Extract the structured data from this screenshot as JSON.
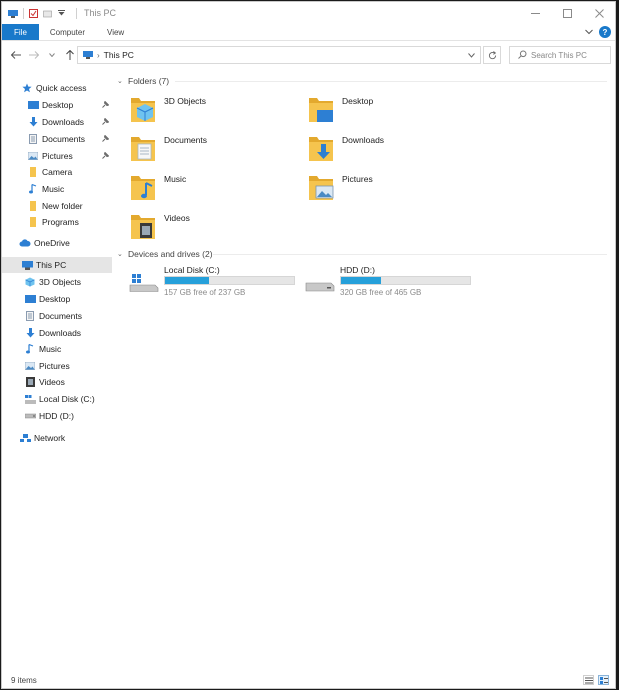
{
  "window": {
    "title": "This PC",
    "qat_dropdown_icon": "chevron-down-icon",
    "colors": {
      "accent": "#1979ca",
      "drive_fill": "#26a0da",
      "folder": "#f5c44e"
    }
  },
  "ribbon": {
    "tabs": [
      {
        "label": "File"
      },
      {
        "label": "Computer"
      },
      {
        "label": "View"
      }
    ],
    "help_label": "?"
  },
  "address": {
    "location": "This PC",
    "search_placeholder": "Search This PC"
  },
  "nav_pane": {
    "quick_access": {
      "label": "Quick access",
      "items": [
        {
          "label": "Desktop",
          "icon": "desktop-icon",
          "pinned": true
        },
        {
          "label": "Downloads",
          "icon": "download-icon",
          "pinned": true
        },
        {
          "label": "Documents",
          "icon": "document-icon",
          "pinned": true
        },
        {
          "label": "Pictures",
          "icon": "picture-icon",
          "pinned": true
        },
        {
          "label": "Camera",
          "icon": "folder-icon",
          "pinned": false
        },
        {
          "label": "Music",
          "icon": "music-icon",
          "pinned": false
        },
        {
          "label": "New folder",
          "icon": "folder-icon",
          "pinned": false
        },
        {
          "label": "Programs",
          "icon": "folder-icon",
          "pinned": false
        }
      ]
    },
    "onedrive": {
      "label": "OneDrive"
    },
    "this_pc": {
      "label": "This PC",
      "items": [
        {
          "label": "3D Objects",
          "icon": "cube-icon"
        },
        {
          "label": "Desktop",
          "icon": "desktop-icon"
        },
        {
          "label": "Documents",
          "icon": "document-icon"
        },
        {
          "label": "Downloads",
          "icon": "download-icon"
        },
        {
          "label": "Music",
          "icon": "music-icon"
        },
        {
          "label": "Pictures",
          "icon": "picture-icon"
        },
        {
          "label": "Videos",
          "icon": "video-icon"
        },
        {
          "label": "Local Disk (C:)",
          "icon": "windows-drive-icon"
        },
        {
          "label": "HDD (D:)",
          "icon": "drive-icon"
        }
      ]
    },
    "network": {
      "label": "Network"
    }
  },
  "main": {
    "folders_header": "Folders (7)",
    "folders": [
      {
        "label": "3D Objects",
        "icon": "cube-folder-icon"
      },
      {
        "label": "Desktop",
        "icon": "desktop-folder-icon"
      },
      {
        "label": "Documents",
        "icon": "documents-folder-icon"
      },
      {
        "label": "Downloads",
        "icon": "downloads-folder-icon"
      },
      {
        "label": "Music",
        "icon": "music-folder-icon"
      },
      {
        "label": "Pictures",
        "icon": "pictures-folder-icon"
      },
      {
        "label": "Videos",
        "icon": "videos-folder-icon"
      }
    ],
    "drives_header": "Devices and drives (2)",
    "drives": [
      {
        "label": "Local Disk (C:)",
        "free_text": "157 GB free of 237 GB",
        "used_fraction": 0.34,
        "icon": "windows-drive-icon"
      },
      {
        "label": "HDD (D:)",
        "free_text": "320 GB free of 465 GB",
        "used_fraction": 0.31,
        "icon": "drive-icon"
      }
    ]
  },
  "status": {
    "item_count": "9 items"
  }
}
